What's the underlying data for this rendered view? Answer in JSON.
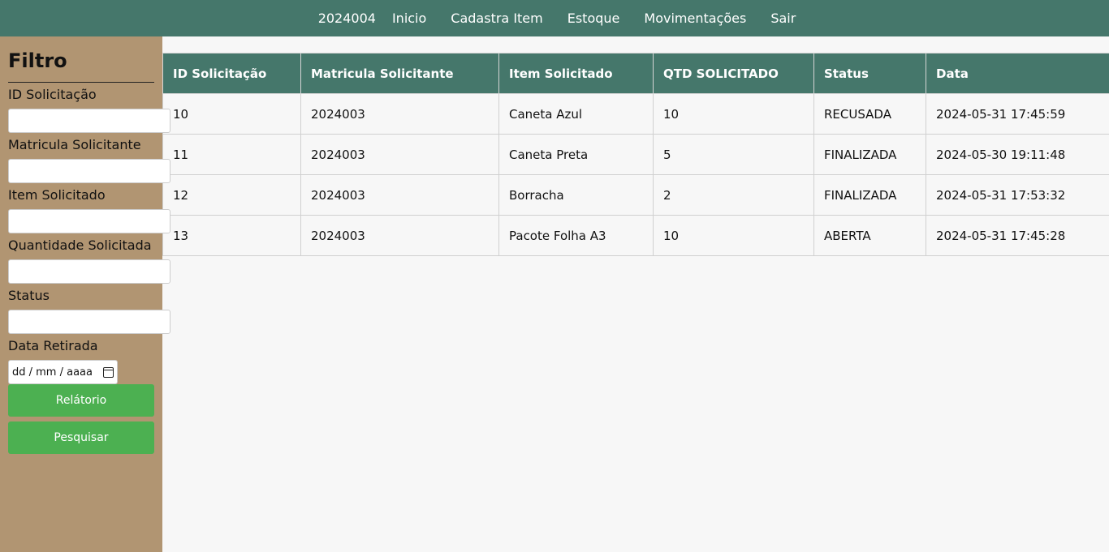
{
  "nav": {
    "user_id": "2024004",
    "items": [
      "Inicio",
      "Cadastra Item",
      "Estoque",
      "Movimentações",
      "Sair"
    ]
  },
  "sidebar": {
    "title": "Filtro",
    "fields": [
      {
        "label": "ID Solicitação",
        "value": ""
      },
      {
        "label": "Matricula Solicitante",
        "value": ""
      },
      {
        "label": "Item Solicitado",
        "value": ""
      },
      {
        "label": "Quantidade Solicitada",
        "value": ""
      },
      {
        "label": "Status",
        "value": ""
      }
    ],
    "date_label": "Data Retirada",
    "date_placeholder": "dd / mm / aaaa",
    "report_button": "Relátorio",
    "search_button": "Pesquisar"
  },
  "table": {
    "headers": [
      "ID Solicitação",
      "Matricula Solicitante",
      "Item Solicitado",
      "QTD SOLICITADO",
      "Status",
      "Data"
    ],
    "rows": [
      [
        "10",
        "2024003",
        "Caneta Azul",
        "10",
        "RECUSADA",
        "2024-05-31 17:45:59"
      ],
      [
        "11",
        "2024003",
        "Caneta Preta",
        "5",
        "FINALIZADA",
        "2024-05-30 19:11:48"
      ],
      [
        "12",
        "2024003",
        "Borracha",
        "2",
        "FINALIZADA",
        "2024-05-31 17:53:32"
      ],
      [
        "13",
        "2024003",
        "Pacote Folha A3",
        "10",
        "ABERTA",
        "2024-05-31 17:45:28"
      ]
    ]
  },
  "colors": {
    "header_bg": "#45776b",
    "sidebar_bg": "#b19572",
    "button_bg": "#4cb051"
  }
}
